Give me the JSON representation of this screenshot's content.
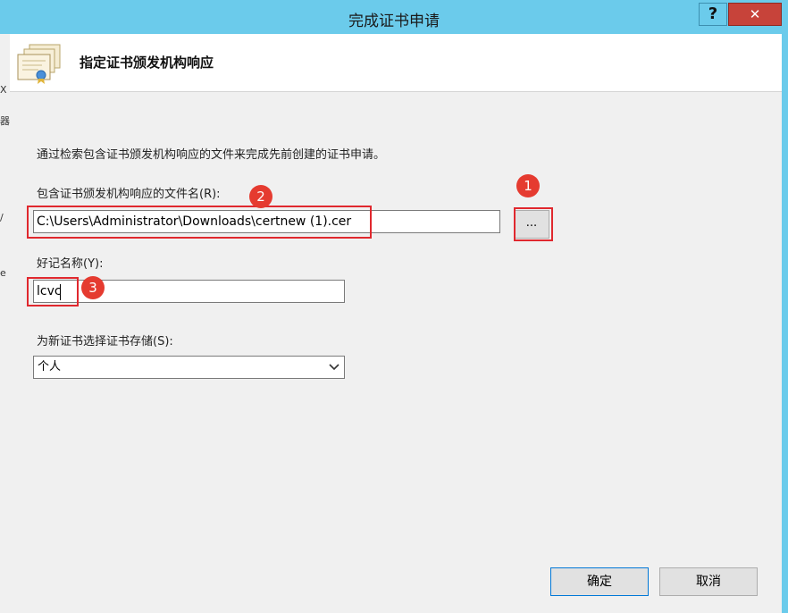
{
  "window": {
    "title": "完成证书申请",
    "help_label": "?",
    "close_label": "✕"
  },
  "header": {
    "title": "指定证书颁发机构响应",
    "icon": "certificate-icon"
  },
  "form": {
    "description": "通过检索包含证书颁发机构响应的文件来完成先前创建的证书申请。",
    "file_label": "包含证书颁发机构响应的文件名(R):",
    "file_value": "C:\\Users\\Administrator\\Downloads\\certnew (1).cer",
    "browse_label": "...",
    "friendly_label": "好记名称(Y):",
    "friendly_value": "lcvc",
    "store_label": "为新证书选择证书存储(S):",
    "store_value": "个人"
  },
  "buttons": {
    "ok": "确定",
    "cancel": "取消"
  },
  "annotations": [
    "1",
    "2",
    "3"
  ],
  "colors": {
    "titlebar": "#6bcbeb",
    "close": "#c7433a",
    "annotation_red": "#e0282e"
  }
}
